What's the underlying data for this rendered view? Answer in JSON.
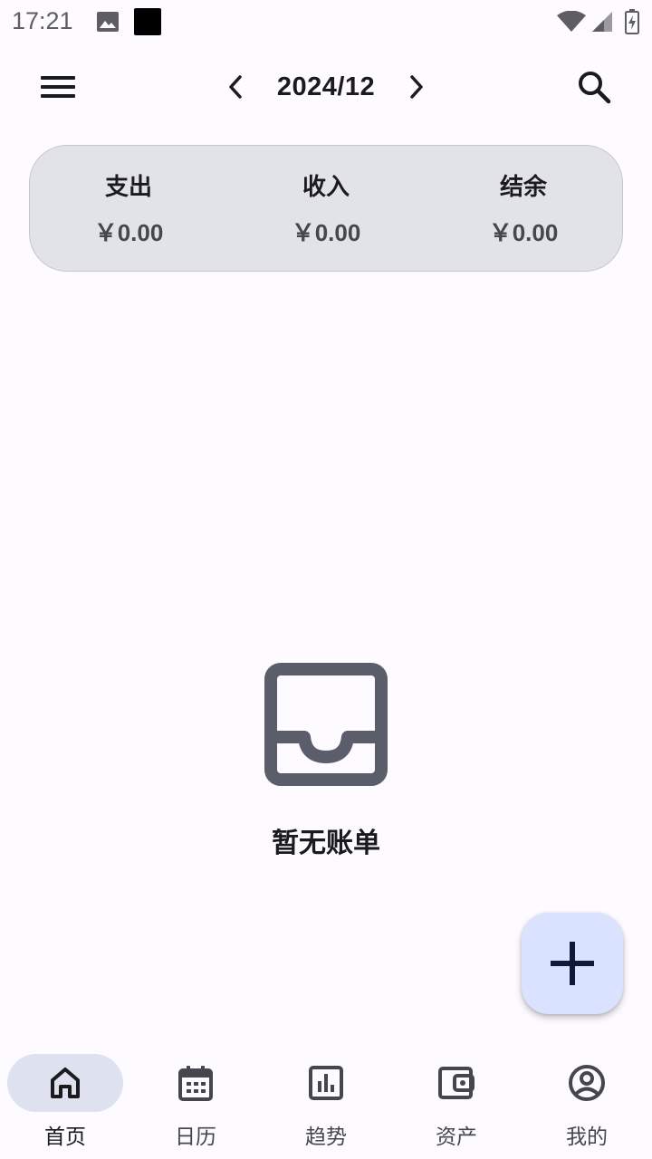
{
  "status_bar": {
    "time": "17:21",
    "icons": [
      "image-icon",
      "black-square",
      "wifi-icon",
      "cell-signal-icon",
      "battery-charging-icon"
    ]
  },
  "top_bar": {
    "month": "2024/12",
    "icons": {
      "menu": "menu-icon",
      "prev": "chevron-left-icon",
      "next": "chevron-right-icon",
      "search": "search-icon"
    }
  },
  "summary": {
    "expense": {
      "label": "支出",
      "value": "￥0.00"
    },
    "income": {
      "label": "收入",
      "value": "￥0.00"
    },
    "balance": {
      "label": "结余",
      "value": "￥0.00"
    }
  },
  "empty_state": {
    "icon": "inbox-icon",
    "message": "暂无账单"
  },
  "fab": {
    "icon": "plus-icon"
  },
  "bottom_nav": {
    "items": [
      {
        "label": "首页",
        "icon": "home-icon",
        "active": true
      },
      {
        "label": "日历",
        "icon": "calendar-icon",
        "active": false
      },
      {
        "label": "趋势",
        "icon": "bar-chart-icon",
        "active": false
      },
      {
        "label": "资产",
        "icon": "wallet-icon",
        "active": false
      },
      {
        "label": "我的",
        "icon": "account-circle-icon",
        "active": false
      }
    ]
  },
  "colors": {
    "background": "#fdfbff",
    "card": "#e2e3e8",
    "fab": "#d9e2ff",
    "nav_active": "#dde1f0",
    "icon_gray": "#5b5d6b"
  }
}
